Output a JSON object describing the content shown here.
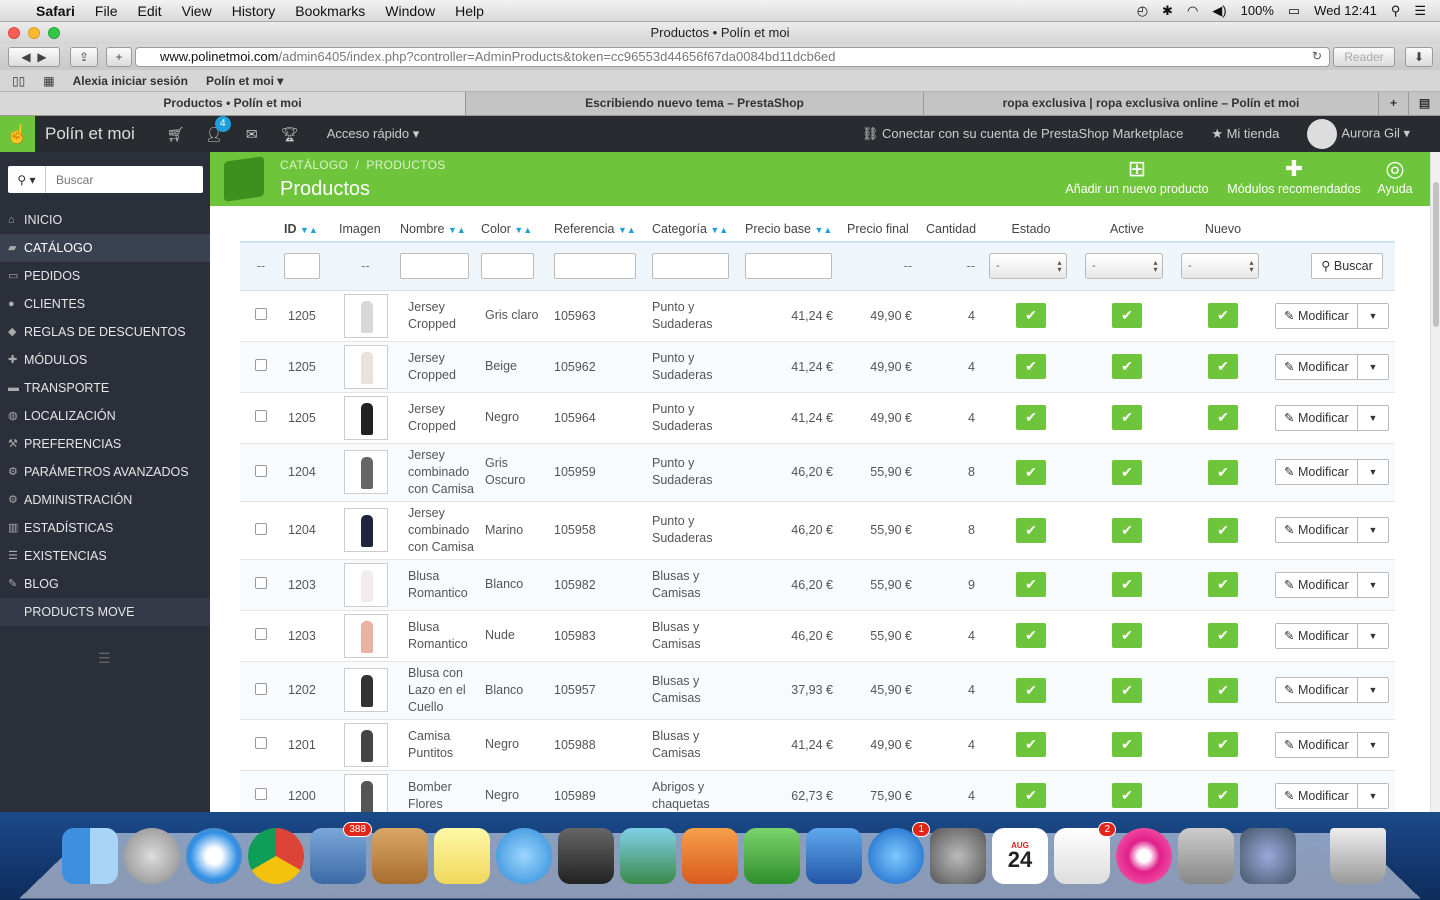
{
  "menubar": {
    "app": "Safari",
    "items": [
      "File",
      "Edit",
      "View",
      "History",
      "Bookmarks",
      "Window",
      "Help"
    ],
    "battery": "100%",
    "clock": "Wed 12:41"
  },
  "window": {
    "title": "Productos • Polín et moi",
    "url_host": "www.polinetmoi.com",
    "url_path": "/admin6405/index.php?controller=AdminProducts&token=cc96553d44656f67da0084bd11dcb6ed",
    "reader_label": "Reader"
  },
  "bookmarks": [
    "Alexia iniciar sesión",
    "Polín et moi ▾"
  ],
  "tabs": [
    "Productos • Polín et moi",
    "Escribiendo nuevo tema – PrestaShop",
    "ropa exclusiva | ropa exclusiva online – Polín et moi"
  ],
  "header": {
    "shop_name": "Polín et moi",
    "notif_count": "4",
    "quick_access": "Acceso rápido ▾",
    "marketplace": "Conectar con su cuenta de PrestaShop Marketplace",
    "my_shop": "Mi tienda",
    "user": "Aurora Gil ▾"
  },
  "sidebar": {
    "search_placeholder": "Buscar",
    "items": [
      {
        "label": "INICIO",
        "icon": "home-icon"
      },
      {
        "label": "CATÁLOGO",
        "icon": "book-icon"
      },
      {
        "label": "PEDIDOS",
        "icon": "credit-card-icon"
      },
      {
        "label": "CLIENTES",
        "icon": "users-icon"
      },
      {
        "label": "REGLAS DE DESCUENTOS",
        "icon": "tag-icon"
      },
      {
        "label": "MÓDULOS",
        "icon": "puzzle-icon"
      },
      {
        "label": "TRANSPORTE",
        "icon": "truck-icon"
      },
      {
        "label": "LOCALIZACIÓN",
        "icon": "globe-icon"
      },
      {
        "label": "PREFERENCIAS",
        "icon": "wrench-icon"
      },
      {
        "label": "PARÁMETROS AVANZADOS",
        "icon": "cogs-icon"
      },
      {
        "label": "ADMINISTRACIÓN",
        "icon": "gear-icon"
      },
      {
        "label": "ESTADÍSTICAS",
        "icon": "bar-chart-icon"
      },
      {
        "label": "EXISTENCIAS",
        "icon": "list-icon"
      },
      {
        "label": "BLOG",
        "icon": "pencil-icon"
      },
      {
        "label": "PRODUCTS MOVE",
        "icon": ""
      }
    ]
  },
  "page": {
    "breadcrumb_1": "CATÁLOGO",
    "breadcrumb_sep": "/",
    "breadcrumb_2": "PRODUCTOS",
    "title": "Productos",
    "action_add": "Añadir un nuevo producto",
    "action_modules": "Módulos recomendados",
    "action_help": "Ayuda"
  },
  "table": {
    "headers": {
      "id": "ID",
      "image": "Imagen",
      "name": "Nombre",
      "color": "Color",
      "ref": "Referencia",
      "category": "Categoría",
      "base_price": "Precio base",
      "final_price": "Precio final",
      "qty": "Cantidad",
      "status": "Estado",
      "active": "Active",
      "new": "Nuevo"
    },
    "filter": {
      "dash": "--",
      "select_value": "-",
      "search_button": "Buscar"
    },
    "edit_label": "Modificar",
    "rows": [
      {
        "id": "1205",
        "name1": "Jersey",
        "name2": "Cropped",
        "name3": "",
        "color1": "Gris claro",
        "color2": "",
        "ref": "105963",
        "cat1": "Punto y",
        "cat2": "Sudaderas",
        "base": "41,24 €",
        "final": "49,90 €",
        "qty": "4",
        "fig": "#d8d8d8"
      },
      {
        "id": "1205",
        "name1": "Jersey",
        "name2": "Cropped",
        "name3": "",
        "color1": "Beige",
        "color2": "",
        "ref": "105962",
        "cat1": "Punto y",
        "cat2": "Sudaderas",
        "base": "41,24 €",
        "final": "49,90 €",
        "qty": "4",
        "fig": "#e8e2d8"
      },
      {
        "id": "1205",
        "name1": "Jersey",
        "name2": "Cropped",
        "name3": "",
        "color1": "Negro",
        "color2": "",
        "ref": "105964",
        "cat1": "Punto y",
        "cat2": "Sudaderas",
        "base": "41,24 €",
        "final": "49,90 €",
        "qty": "4",
        "fig": "#222"
      },
      {
        "id": "1204",
        "name1": "Jersey",
        "name2": "combinado",
        "name3": "con Camisa",
        "color1": "Gris",
        "color2": "Oscuro",
        "ref": "105959",
        "cat1": "Punto y",
        "cat2": "Sudaderas",
        "base": "46,20 €",
        "final": "55,90 €",
        "qty": "8",
        "fig": "#666"
      },
      {
        "id": "1204",
        "name1": "Jersey",
        "name2": "combinado",
        "name3": "con Camisa",
        "color1": "Marino",
        "color2": "",
        "ref": "105958",
        "cat1": "Punto y",
        "cat2": "Sudaderas",
        "base": "46,20 €",
        "final": "55,90 €",
        "qty": "8",
        "fig": "#1c2440"
      },
      {
        "id": "1203",
        "name1": "Blusa",
        "name2": "Romantico",
        "name3": "",
        "color1": "Blanco",
        "color2": "",
        "ref": "105982",
        "cat1": "Blusas y",
        "cat2": "Camisas",
        "base": "46,20 €",
        "final": "55,90 €",
        "qty": "9",
        "fig": "#f2ecec"
      },
      {
        "id": "1203",
        "name1": "Blusa",
        "name2": "Romantico",
        "name3": "",
        "color1": "Nude",
        "color2": "",
        "ref": "105983",
        "cat1": "Blusas y",
        "cat2": "Camisas",
        "base": "46,20 €",
        "final": "55,90 €",
        "qty": "4",
        "fig": "#e8b3a0"
      },
      {
        "id": "1202",
        "name1": "Blusa con",
        "name2": "Lazo en el",
        "name3": "Cuello",
        "color1": "Blanco",
        "color2": "",
        "ref": "105957",
        "cat1": "Blusas y",
        "cat2": "Camisas",
        "base": "37,93 €",
        "final": "45,90 €",
        "qty": "4",
        "fig": "#333"
      },
      {
        "id": "1201",
        "name1": "Camisa",
        "name2": "Puntitos",
        "name3": "",
        "color1": "Negro",
        "color2": "",
        "ref": "105988",
        "cat1": "Blusas y",
        "cat2": "Camisas",
        "base": "41,24 €",
        "final": "49,90 €",
        "qty": "4",
        "fig": "#444"
      },
      {
        "id": "1200",
        "name1": "Bomber",
        "name2": "Flores",
        "name3": "",
        "color1": "Negro",
        "color2": "",
        "ref": "105989",
        "cat1": "Abrigos y",
        "cat2": "chaquetas",
        "base": "62,73 €",
        "final": "75,90 €",
        "qty": "4",
        "fig": "#555"
      }
    ]
  },
  "dock": {
    "mail_badge": "388",
    "appstore_badge": "1",
    "reminders_badge": "2",
    "calendar_month": "AUG",
    "calendar_day": "24"
  }
}
